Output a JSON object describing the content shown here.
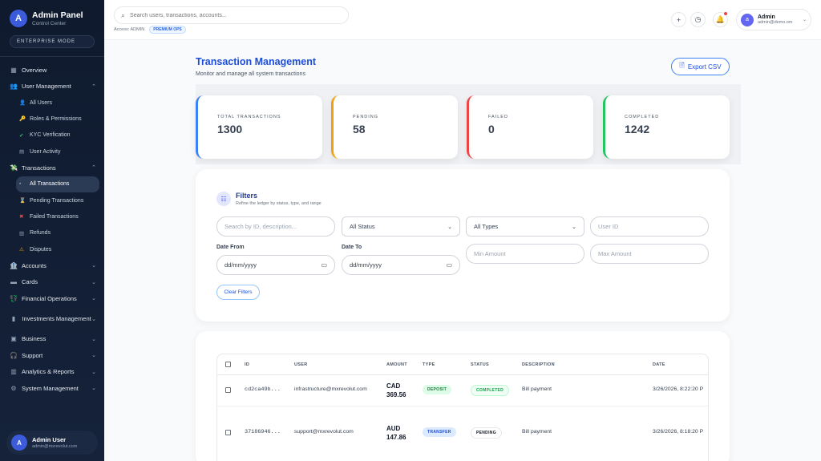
{
  "brand": {
    "logo_letter": "A",
    "title": "Admin Panel",
    "subtitle": "Control Center",
    "mode": "ENTERPRISE MODE"
  },
  "sidebar": {
    "items": [
      {
        "label": "Overview",
        "icon": "grid-icon"
      },
      {
        "label": "User Management",
        "icon": "users-icon",
        "expanded": true,
        "children": [
          {
            "label": "All Users",
            "icon": "person-icon"
          },
          {
            "label": "Roles & Permissions",
            "icon": "key-icon"
          },
          {
            "label": "KYC Verification",
            "icon": "check-icon"
          },
          {
            "label": "User Activity",
            "icon": "document-icon"
          }
        ]
      },
      {
        "label": "Transactions",
        "icon": "money-icon",
        "expanded": true,
        "children": [
          {
            "label": "All Transactions",
            "icon": "list-icon",
            "active": true
          },
          {
            "label": "Pending Transactions",
            "icon": "hourglass-icon"
          },
          {
            "label": "Failed Transactions",
            "icon": "x-icon"
          },
          {
            "label": "Refunds",
            "icon": "refund-icon"
          },
          {
            "label": "Disputes",
            "icon": "warning-icon"
          }
        ]
      },
      {
        "label": "Accounts",
        "icon": "bank-icon"
      },
      {
        "label": "Cards",
        "icon": "card-icon"
      },
      {
        "label": "Financial Operations",
        "icon": "ops-icon"
      },
      {
        "label": "Investments Management",
        "icon": "chart-icon"
      },
      {
        "label": "Business",
        "icon": "building-icon"
      },
      {
        "label": "Support",
        "icon": "headset-icon"
      },
      {
        "label": "Analytics & Reports",
        "icon": "analytics-icon"
      },
      {
        "label": "System Management",
        "icon": "gear-icon"
      }
    ],
    "user": {
      "initial": "A",
      "name": "Admin User",
      "email": "admin@mxrevolut.com"
    }
  },
  "topbar": {
    "search_placeholder": "Search users, transactions, accounts...",
    "access_label": "Access: ADMIN",
    "premium_badge": "PREMIUM OPS",
    "profile": {
      "initial": "a",
      "name": "Admin",
      "email": "admin@demo.om"
    }
  },
  "page": {
    "title": "Transaction Management",
    "subtitle": "Monitor and manage all system transactions",
    "export_label": "Export CSV"
  },
  "stats": [
    {
      "label": "TOTAL TRANSACTIONS",
      "value": "1300",
      "color": "#3b82f6"
    },
    {
      "label": "PENDING",
      "value": "58",
      "color": "#f59e0b"
    },
    {
      "label": "FAILED",
      "value": "0",
      "color": "#ef4444"
    },
    {
      "label": "COMPLETED",
      "value": "1242",
      "color": "#22c55e"
    }
  ],
  "filters": {
    "title": "Filters",
    "subtitle": "Refine the ledger by status, type, and range",
    "search_placeholder": "Search by ID, description...",
    "status_value": "All Status",
    "type_value": "All Types",
    "user_id_placeholder": "User ID",
    "date_from_label": "Date From",
    "date_to_label": "Date To",
    "date_placeholder": "dd/mm/yyyy",
    "min_amount_placeholder": "Min Amount",
    "max_amount_placeholder": "Max Amount",
    "clear_label": "Clear Filters"
  },
  "table": {
    "columns": [
      "ID",
      "USER",
      "AMOUNT",
      "TYPE",
      "STATUS",
      "DESCRIPTION",
      "DATE"
    ],
    "rows": [
      {
        "id": "cd2ca49b...",
        "user": "infrastructure@mxrevolut.com",
        "currency": "CAD",
        "amount": "369.56",
        "type": "DEPOSIT",
        "status": "COMPLETED",
        "description": "Bill payment",
        "date": "3/26/2026, 8:22:20 P"
      },
      {
        "id": "37186946...",
        "user": "support@mxrevolut.com",
        "currency": "AUD",
        "amount": "147.86",
        "type": "TRANSFER",
        "status": "PENDING",
        "description": "Bill payment",
        "date": "3/26/2026, 8:18:20 P"
      }
    ]
  }
}
